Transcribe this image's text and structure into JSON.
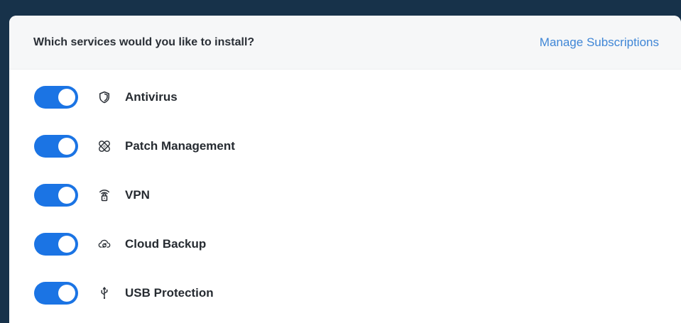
{
  "header": {
    "title": "Which services would you like to install?",
    "manage_link": "Manage Subscriptions"
  },
  "services": [
    {
      "label": "Antivirus",
      "icon": "shield-icon",
      "enabled": true
    },
    {
      "label": "Patch Management",
      "icon": "patch-icon",
      "enabled": true
    },
    {
      "label": "VPN",
      "icon": "vpn-lock-icon",
      "enabled": true
    },
    {
      "label": "Cloud Backup",
      "icon": "cloud-backup-icon",
      "enabled": true
    },
    {
      "label": "USB Protection",
      "icon": "usb-icon",
      "enabled": true
    }
  ],
  "colors": {
    "toggle_on": "#1b74e4",
    "link": "#3f86d6",
    "background": "#17324a"
  }
}
